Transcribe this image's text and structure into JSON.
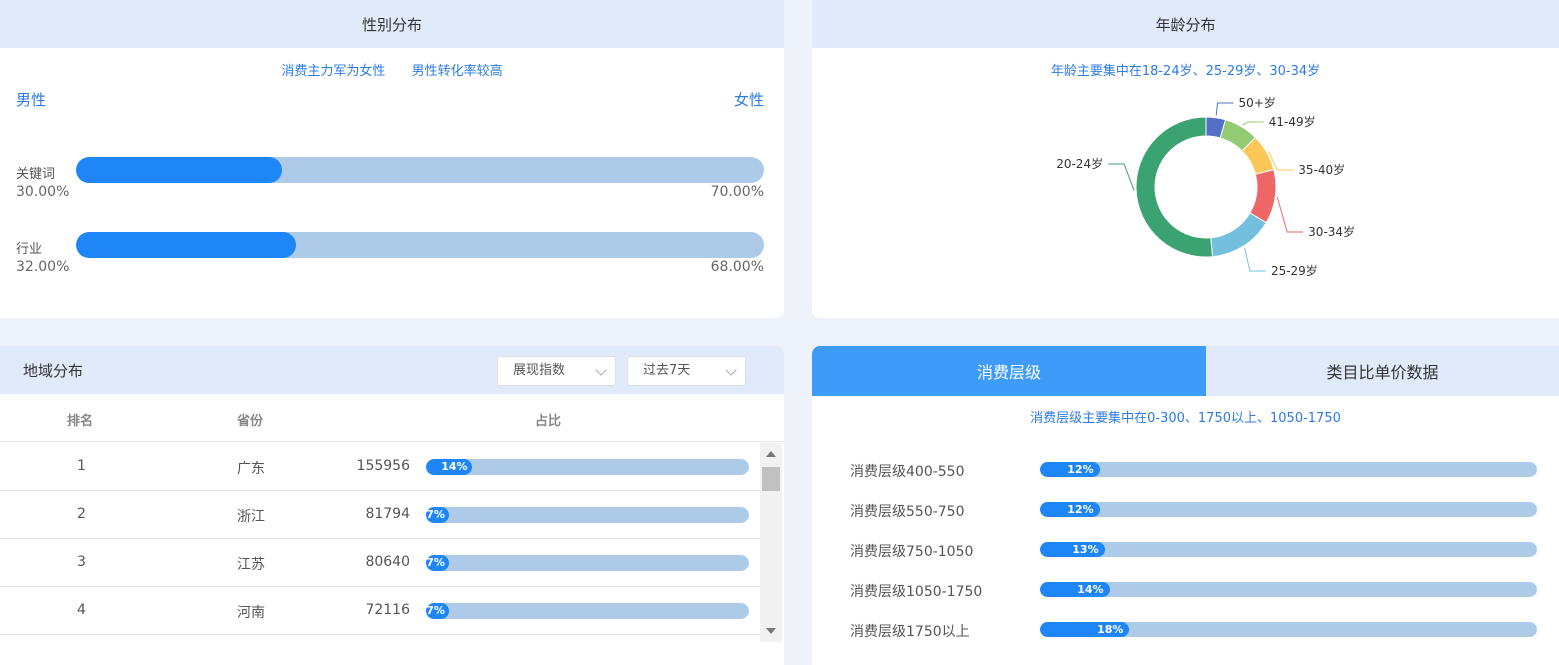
{
  "gender": {
    "title": "性别分布",
    "subtitles": [
      "消费主力军为女性",
      "男性转化率较高"
    ],
    "male_label": "男性",
    "female_label": "女性",
    "rows": [
      {
        "label": "关键词",
        "male_pct_text": "30.00%",
        "female_pct_text": "70.00%",
        "male": 30
      },
      {
        "label": "行业",
        "male_pct_text": "32.00%",
        "female_pct_text": "68.00%",
        "male": 32
      }
    ],
    "colors": {
      "male": "#1e86f7",
      "female": "#adcbe8"
    }
  },
  "age": {
    "title": "年龄分布",
    "subtitle": "年龄主要集中在18-24岁、25-29岁、30-34岁",
    "chart_data": {
      "type": "pie",
      "categories": [
        "50+岁",
        "41-49岁",
        "35-40岁",
        "30-34岁",
        "25-29岁",
        "20-24岁"
      ],
      "values": [
        4.5,
        8,
        8.5,
        12.5,
        15,
        51.5
      ],
      "colors": [
        "#5470c6",
        "#91cc75",
        "#fac858",
        "#ee6666",
        "#73c0de",
        "#3ba272"
      ]
    }
  },
  "region": {
    "title": "地域分布",
    "select_metric": "展现指数",
    "select_period": "过去7天",
    "columns": [
      "排名",
      "省份",
      "占比"
    ],
    "rows": [
      {
        "rank": "1",
        "province": "广东",
        "value": "155956",
        "pct": "14%",
        "pct_num": 14
      },
      {
        "rank": "2",
        "province": "浙江",
        "value": "81794",
        "pct": "7%",
        "pct_num": 7
      },
      {
        "rank": "3",
        "province": "江苏",
        "value": "80640",
        "pct": "7%",
        "pct_num": 7
      },
      {
        "rank": "4",
        "province": "河南",
        "value": "72116",
        "pct": "7%",
        "pct_num": 7
      }
    ]
  },
  "consume": {
    "tabs": [
      "消费层级",
      "类目比单价数据"
    ],
    "subtitle": "消费层级主要集中在0-300、1750以上、1050-1750",
    "rows": [
      {
        "label": "消费层级400-550",
        "pct": "12%",
        "pct_num": 12
      },
      {
        "label": "消费层级550-750",
        "pct": "12%",
        "pct_num": 12
      },
      {
        "label": "消费层级750-1050",
        "pct": "13%",
        "pct_num": 13
      },
      {
        "label": "消费层级1050-1750",
        "pct": "14%",
        "pct_num": 14
      },
      {
        "label": "消费层级1750以上",
        "pct": "18%",
        "pct_num": 18
      }
    ]
  }
}
